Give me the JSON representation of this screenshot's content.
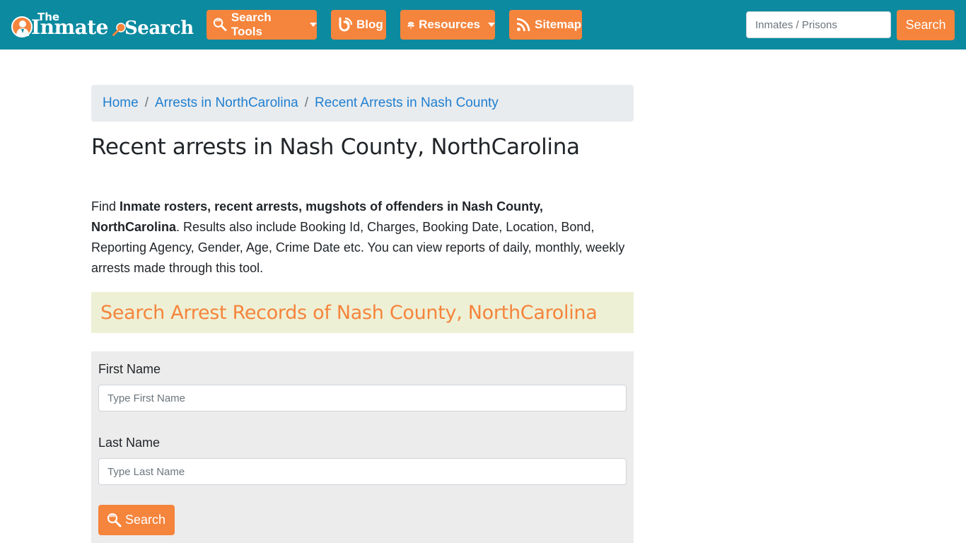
{
  "brand": {
    "line1": "The",
    "line2": "Inmate",
    "line3": "Search"
  },
  "nav": {
    "search_tools": "Search Tools",
    "blog": "Blog",
    "resources": "Resources",
    "sitemap": "Sitemap"
  },
  "top_search": {
    "placeholder": "Inmates / Prisons",
    "button": "Search"
  },
  "breadcrumb": {
    "items": [
      "Home",
      "Arrests in NorthCarolina",
      "Recent Arrests in Nash County"
    ],
    "separator": "/"
  },
  "page": {
    "title": "Recent arrests in Nash County, NorthCarolina",
    "intro_prefix": "Find ",
    "intro_bold": "Inmate rosters, recent arrests, mugshots of offenders in Nash County, NorthCarolina",
    "intro_suffix": ". Results also include Booking Id, Charges, Booking Date, Location, Bond, Reporting Agency, Gender, Age, Crime Date etc. You can view reports of daily, monthly, weekly arrests made through this tool."
  },
  "section": {
    "heading": "Search Arrest Records of Nash County, NorthCarolina"
  },
  "form": {
    "first_name_label": "First Name",
    "first_name_placeholder": "Type First Name",
    "last_name_label": "Last Name",
    "last_name_placeholder": "Type Last Name",
    "submit": "Search"
  },
  "colors": {
    "navbar": "#0b8aa0",
    "accent": "#f5843c",
    "link": "#1f7fd1",
    "section_bg": "#eef0d5",
    "form_bg": "#ececec"
  }
}
